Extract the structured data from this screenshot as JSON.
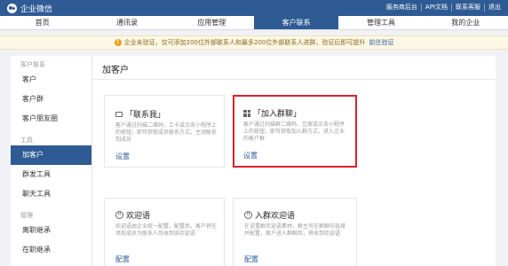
{
  "app": {
    "logo_text": "企业微信"
  },
  "top_links": [
    "服务商后台",
    "API文档",
    "联系客服",
    "退出"
  ],
  "nav": {
    "tabs": [
      "首页",
      "通讯录",
      "应用管理",
      "客户联系",
      "管理工具",
      "我的企业"
    ],
    "active_index": 3
  },
  "notice": {
    "icon": "!",
    "text": "企业未验证，仅可添加200位外部联系人和最多200位外部联系人进群，验证后即可提升",
    "link": "前往验证"
  },
  "sidebar": {
    "group_customer": "客户联系",
    "customer_items": [
      "客户",
      "客户群",
      "客户朋友圈"
    ],
    "group_tools": "工具",
    "tool_items": [
      "加客户",
      "群发工具",
      "聊天工具"
    ],
    "group_manage": "管理",
    "manage_items": [
      "离职继承",
      "在职继承"
    ],
    "active_item": "加客户"
  },
  "main": {
    "title": "加客户",
    "cards": [
      {
        "title": "「联系我」",
        "desc": "客户通过扫描二维码、工卡或点击小程序上的按钮，即可获取成员联系方式，主动联系到成员",
        "action": "设置",
        "icon": "chat-icon"
      },
      {
        "title": "「加入群聊」",
        "desc": "客户通过扫描群二维码、互搜或点击小程序上的按钮，即可获取加入群方式，进入企业的客户群",
        "action": "设置",
        "icon": "group-qr-icon"
      },
      {
        "title": "欢迎语",
        "desc": "欢迎语由企业统一配置，配置后，客户将在添加成员为联系人后收到该欢迎语",
        "action": "配置",
        "icon": "welcome-icon"
      },
      {
        "title": "入群欢迎语",
        "desc": "在设置群欢迎语素材，群主可在群聊中选择并配置，客户进入群聊后，将收到欢迎语",
        "action": "配置",
        "icon": "group-welcome-icon"
      }
    ]
  },
  "colors": {
    "brand": "#2e5b94",
    "highlight": "#d9222a"
  }
}
